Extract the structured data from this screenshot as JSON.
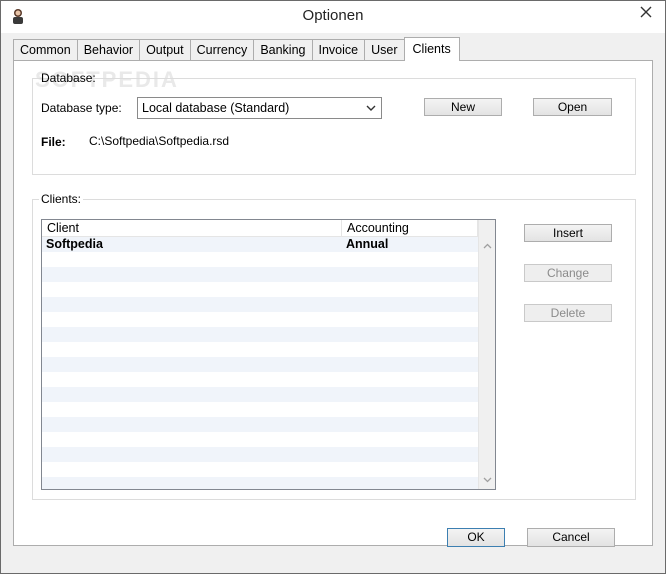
{
  "window": {
    "title": "Optionen"
  },
  "tabs": [
    {
      "label": "Common"
    },
    {
      "label": "Behavior"
    },
    {
      "label": "Output"
    },
    {
      "label": "Currency"
    },
    {
      "label": "Banking"
    },
    {
      "label": "Invoice"
    },
    {
      "label": "User"
    },
    {
      "label": "Clients",
      "active": true
    }
  ],
  "database": {
    "group_label": "Database:",
    "type_label": "Database type:",
    "type_value": "Local database (Standard)",
    "new_label": "New",
    "open_label": "Open",
    "file_label": "File:",
    "file_value": "C:\\Softpedia\\Softpedia.rsd"
  },
  "clients": {
    "group_label": "Clients:",
    "columns": [
      "Client",
      "Accounting"
    ],
    "rows": [
      {
        "client": "Softpedia",
        "accounting": "Annual"
      }
    ],
    "insert_label": "Insert",
    "change_label": "Change",
    "delete_label": "Delete"
  },
  "footer": {
    "ok_label": "OK",
    "cancel_label": "Cancel"
  },
  "watermark": "SOFTPEDIA",
  "colors": {
    "window_bg": "#f0f0f0",
    "panel_bg": "#ffffff",
    "alt_row": "#f0f4fa",
    "default_button_border": "#3c7fb1"
  }
}
